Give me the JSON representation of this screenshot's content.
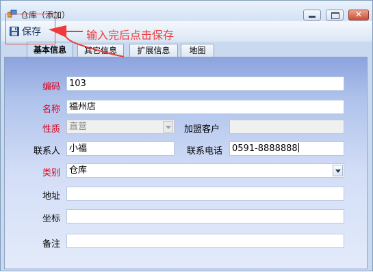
{
  "window": {
    "title": "仓库（添加）",
    "controls": {
      "min": "",
      "max": "",
      "close": "✕"
    }
  },
  "toolbar": {
    "save_label": "保存"
  },
  "annotation": {
    "text": "输入完后点击保存",
    "color": "#ee3a3a"
  },
  "tabs": [
    {
      "label": "基本信息",
      "active": true
    },
    {
      "label": "其它信息",
      "active": false
    },
    {
      "label": "扩展信息",
      "active": false
    },
    {
      "label": "地图",
      "active": false
    }
  ],
  "form": {
    "code": {
      "label": "编码",
      "value": "103",
      "required": true
    },
    "name": {
      "label": "名称",
      "value": "福州店",
      "required": true
    },
    "nature": {
      "label": "性质",
      "value": "直营",
      "required": true,
      "disabled": true
    },
    "franchisee": {
      "label": "加盟客户",
      "value": "",
      "disabled": true
    },
    "contact": {
      "label": "联系人",
      "value": "小福"
    },
    "phone": {
      "label": "联系电话",
      "value": "0591-8888888"
    },
    "category": {
      "label": "类别",
      "value": "仓库",
      "required": true
    },
    "address": {
      "label": "地址",
      "value": ""
    },
    "coords": {
      "label": "坐标",
      "value": ""
    },
    "remark": {
      "label": "备注",
      "value": ""
    }
  },
  "colors": {
    "required_label": "#d8001b",
    "panel_top": "#8ca3de",
    "panel_bottom": "#e3ebfa"
  }
}
